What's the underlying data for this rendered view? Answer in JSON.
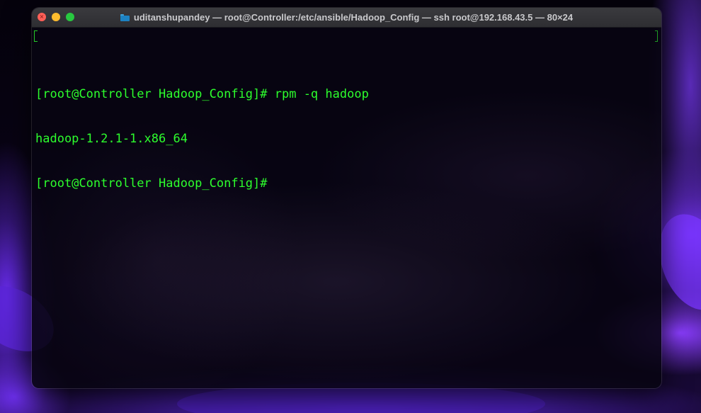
{
  "window": {
    "title": "uditanshupandey — root@Controller:/etc/ansible/Hadoop_Config — ssh root@192.168.43.5 — 80×24",
    "title_icon": "folder-icon"
  },
  "traffic_lights": {
    "close_color": "#ff5f57",
    "minimize_color": "#febc2e",
    "zoom_color": "#28c840"
  },
  "terminal": {
    "text_color": "#2dff2d",
    "lines": [
      "[root@Controller Hadoop_Config]# rpm -q hadoop",
      "hadoop-1.2.1-1.x86_64",
      "[root@Controller Hadoop_Config]#"
    ]
  }
}
